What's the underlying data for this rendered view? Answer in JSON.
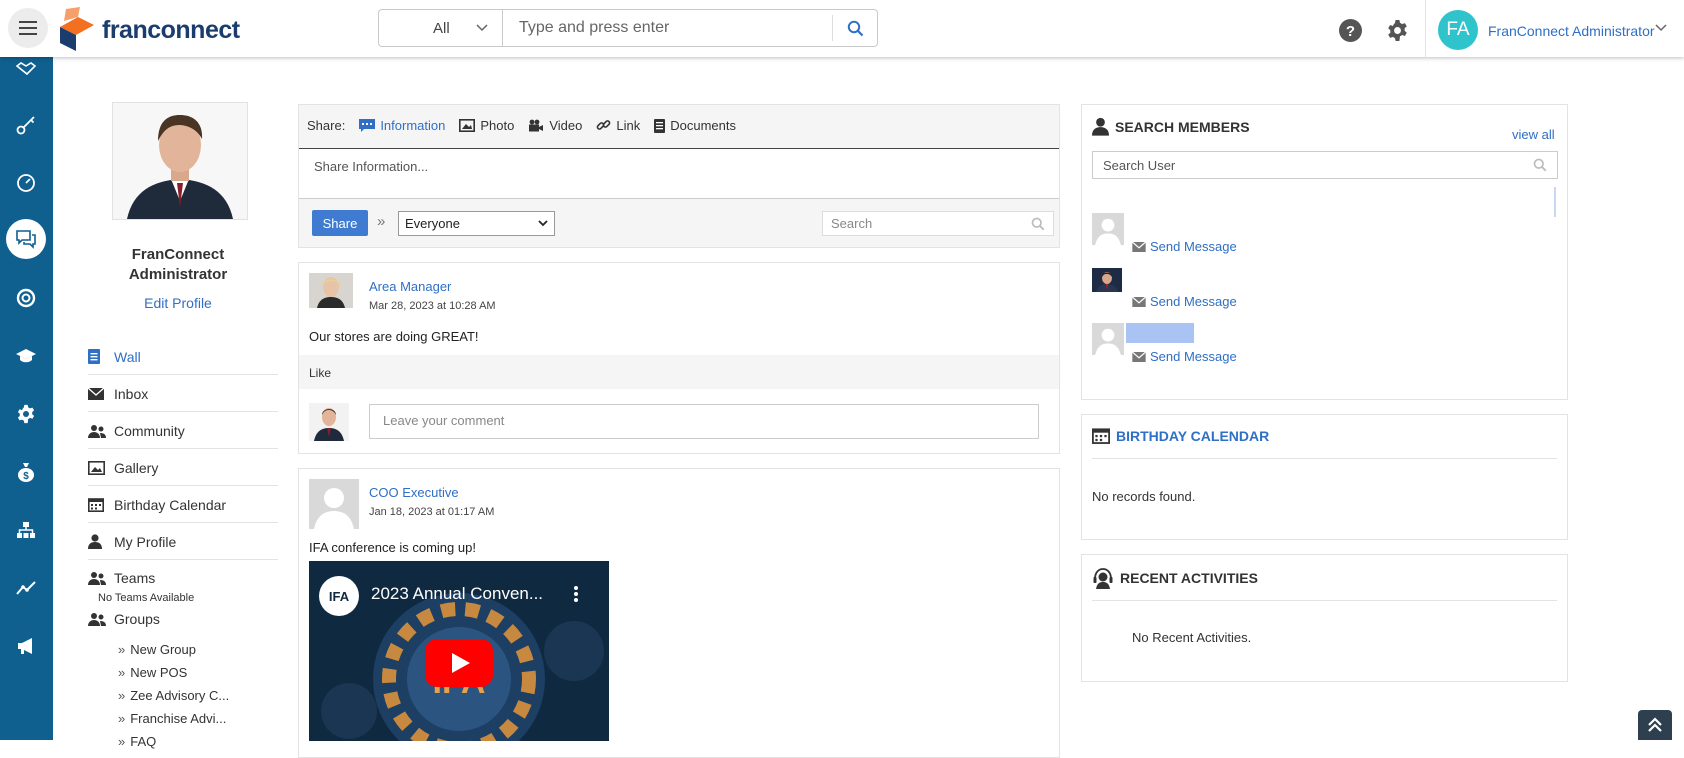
{
  "header": {
    "logo_text": "franconnect",
    "search": {
      "scope_value": "All",
      "placeholder": "Type and press enter"
    },
    "user": {
      "initials": "FA",
      "name": "FranConnect Administrator"
    }
  },
  "rail": {
    "items": [
      "handshake-icon",
      "key-icon",
      "gauge-icon",
      "chat-icon",
      "lifebuoy-icon",
      "graduation-cap-icon",
      "settings-icon",
      "money-bag-icon",
      "org-chart-icon",
      "analytics-icon",
      "megaphone-icon"
    ],
    "active": "chat-icon"
  },
  "profile": {
    "name_line1": "FranConnect",
    "name_line2": "Administrator",
    "edit_label": "Edit Profile"
  },
  "nav": {
    "wall": "Wall",
    "inbox": "Inbox",
    "community": "Community",
    "gallery": "Gallery",
    "birthday": "Birthday Calendar",
    "my_profile": "My Profile",
    "teams": "Teams",
    "teams_note": "No Teams Available",
    "groups": "Groups",
    "group_items": [
      "New Group",
      "New POS",
      "Zee Advisory C...",
      "Franchise Advi...",
      "FAQ"
    ]
  },
  "share": {
    "label": "Share:",
    "tabs": [
      "Information",
      "Photo",
      "Video",
      "Link",
      "Documents"
    ],
    "active_tab": "Information",
    "placeholder": "Share Information...",
    "button": "Share",
    "audience": "Everyone",
    "search_placeholder": "Search"
  },
  "posts": [
    {
      "author": "Area Manager",
      "date": "Mar 28, 2023 at 10:28 AM",
      "text": "Our stores are doing GREAT!",
      "like_label": "Like",
      "comment_placeholder": "Leave your comment"
    },
    {
      "author": "COO Executive",
      "date": "Jan 18, 2023 at 01:17 AM",
      "text": "IFA conference is coming up!",
      "video_title": "2023 Annual Conven...",
      "video_channel": "IFA"
    }
  ],
  "search_members": {
    "title": "SEARCH MEMBERS",
    "view_all": "view all",
    "placeholder": "Search User",
    "send_label": "Send Message"
  },
  "birthday_calendar": {
    "title": "BIRTHDAY CALENDAR",
    "empty": "No records found."
  },
  "recent_activities": {
    "title": "RECENT ACTIVITIES",
    "empty": "No Recent Activities."
  },
  "colors": {
    "rail": "#0f5f8f",
    "link": "#2f6fc5",
    "avatar": "#2fc4cc",
    "share_button": "#3f7bd0"
  }
}
